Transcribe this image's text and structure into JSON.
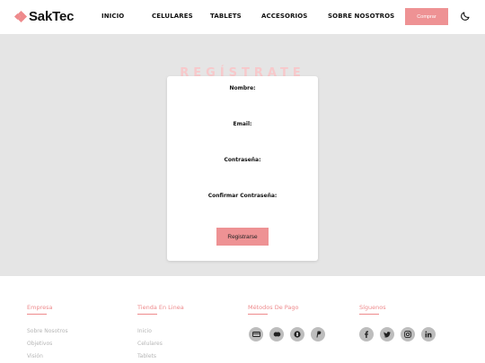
{
  "header": {
    "brand": "SakTec",
    "nav": [
      "INICIO",
      "CELULARES",
      "TABLETS",
      "ACCESORIOS",
      "SOBRE NOSOTROS"
    ],
    "buy_label": "Comprar"
  },
  "main": {
    "title": "REGÍSTRATE",
    "fields": [
      {
        "label": "Nombre:"
      },
      {
        "label": "Email:"
      },
      {
        "label": "Contraseña:"
      },
      {
        "label": "Confirmar Contraseña:"
      }
    ],
    "submit_label": "Registrarse"
  },
  "footer": {
    "company": {
      "title": "Empresa",
      "links": [
        "Sobre Nosotros",
        "Objetivos",
        "Visión"
      ]
    },
    "store": {
      "title": "Tienda En Linea",
      "links": [
        "Inicio",
        "Celulares",
        "Tablets"
      ]
    },
    "payment": {
      "title": "Métodos De Pago",
      "icons": [
        "credit-card-icon",
        "mastercard-icon",
        "bitcoin-icon",
        "paypal-icon"
      ]
    },
    "social": {
      "title": "Síguenos",
      "icons": [
        "facebook-icon",
        "twitter-icon",
        "instagram-icon",
        "linkedin-icon"
      ]
    }
  },
  "colors": {
    "accent": "#ee9294",
    "background": "#e5e5e5",
    "card": "#ffffff"
  }
}
